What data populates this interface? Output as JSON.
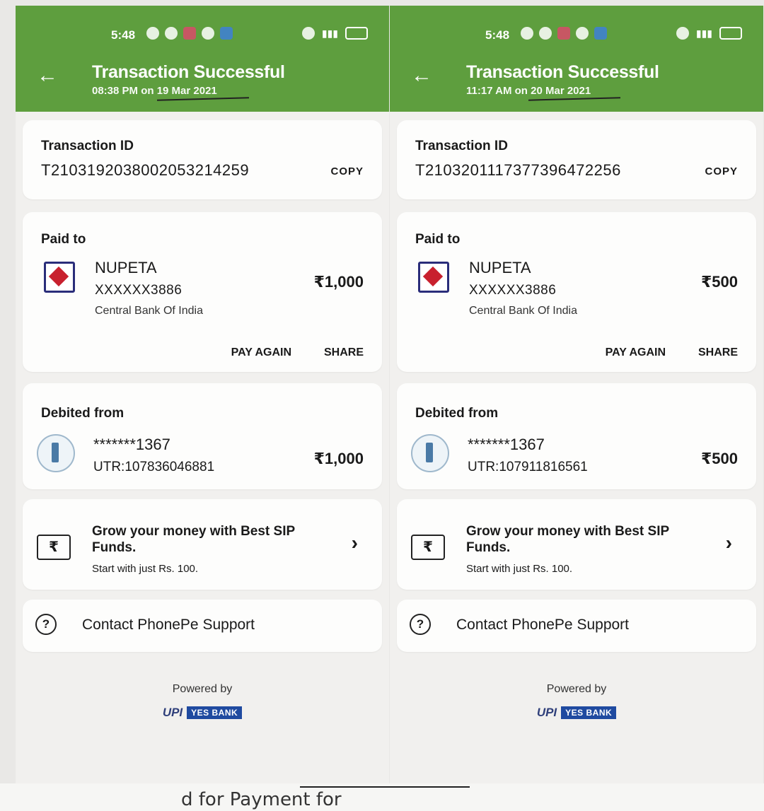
{
  "panels": [
    {
      "time": "5:48",
      "title": "Transaction Successful",
      "subtitle": "08:38 PM on 19 Mar 2021",
      "transaction_label": "Transaction ID",
      "transaction_id": "T2103192038002053214259",
      "copy_label": "COPY",
      "paid_to_label": "Paid to",
      "payee_name": "NUPETA",
      "payee_account": "XXXXXX3886",
      "payee_bank": "Central Bank Of India",
      "amount": "₹1,000",
      "pay_again_label": "PAY AGAIN",
      "share_label": "SHARE",
      "debited_label": "Debited from",
      "debit_account": "*******1367",
      "utr": "UTR:107836046881",
      "debit_amount": "₹1,000",
      "sip_title": "Grow your money with Best SIP Funds.",
      "sip_subtitle": "Start with just Rs. 100.",
      "support_label": "Contact PhonePe Support",
      "powered_by": "Powered by",
      "upi_logo": "UPI",
      "bank_logo": "YES BANK"
    },
    {
      "time": "5:48",
      "title": "Transaction Successful",
      "subtitle": "11:17 AM on 20 Mar 2021",
      "transaction_label": "Transaction ID",
      "transaction_id": "T2103201117377396472256",
      "copy_label": "COPY",
      "paid_to_label": "Paid to",
      "payee_name": "NUPETA",
      "payee_account": "XXXXXX3886",
      "payee_bank": "Central Bank Of India",
      "amount": "₹500",
      "pay_again_label": "PAY AGAIN",
      "share_label": "SHARE",
      "debited_label": "Debited from",
      "debit_account": "*******1367",
      "utr": "UTR:107911816561",
      "debit_amount": "₹500",
      "sip_title": "Grow your money with Best SIP Funds.",
      "sip_subtitle": "Start with just Rs. 100.",
      "support_label": "Contact PhonePe Support",
      "powered_by": "Powered by",
      "upi_logo": "UPI",
      "bank_logo": "YES BANK"
    }
  ],
  "bottom_note": "d for Payment for",
  "icons": {
    "back": "arrow-left-icon",
    "payee_bank": "central-bank-logo-icon",
    "debit_bank": "bank-emblem-icon",
    "sip": "rupee-wallet-icon",
    "chevron": "chevron-right-icon",
    "support": "question-circle-icon"
  },
  "colors": {
    "header_green": "#5e9e3e",
    "upi_navy": "#2f3f7a",
    "yes_blue": "#1f4aa0"
  }
}
